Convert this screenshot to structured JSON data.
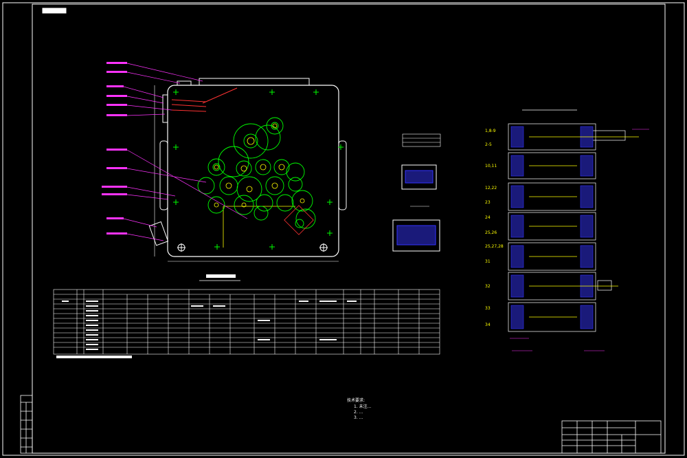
{
  "drawing": {
    "title_block_tag": "",
    "plate_caption": "",
    "notes_title": "技术要求:",
    "notes": [
      "1. 未注...",
      "2. ...",
      "3. ..."
    ],
    "row_labels": [
      "1,8-9",
      "2-5",
      "10,11",
      "12,22",
      "23",
      "24",
      "25,26",
      "25,27,28",
      "31",
      "32",
      "33",
      "34"
    ]
  },
  "colors": {
    "frame": "#ffffff",
    "outline": "#ffffff",
    "leader": "#ff33ff",
    "gear": "#00ff00",
    "mark": "#ffff00",
    "section": "#3333ff",
    "red": "#ff3333"
  },
  "icons": [
    "centerline-cross-icon",
    "gear-circle-icon",
    "bolt-hole-icon"
  ]
}
